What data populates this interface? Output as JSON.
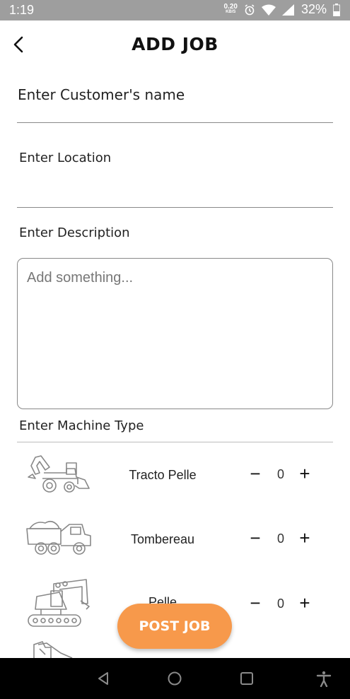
{
  "status_bar": {
    "time": "1:19",
    "net_speed": "0.20",
    "net_unit": "KB/S",
    "battery": "32%"
  },
  "header": {
    "title": "ADD JOB"
  },
  "form": {
    "customer_label": "Enter Customer's name",
    "location_label": "Enter Location",
    "description_label": "Enter Description",
    "description_placeholder": "Add something...",
    "machine_type_label": "Enter Machine Type"
  },
  "machines": [
    {
      "name": "Tracto Pelle",
      "qty": "0",
      "icon": "backhoe-loader-icon"
    },
    {
      "name": "Tombereau",
      "qty": "0",
      "icon": "dump-truck-icon"
    },
    {
      "name": "Pelle",
      "qty": "0",
      "icon": "excavator-icon"
    }
  ],
  "actions": {
    "post_label": "POST JOB"
  },
  "colors": {
    "accent": "#f7994b",
    "status_bar": "#9e9e9e",
    "nav_bar": "#000000"
  }
}
